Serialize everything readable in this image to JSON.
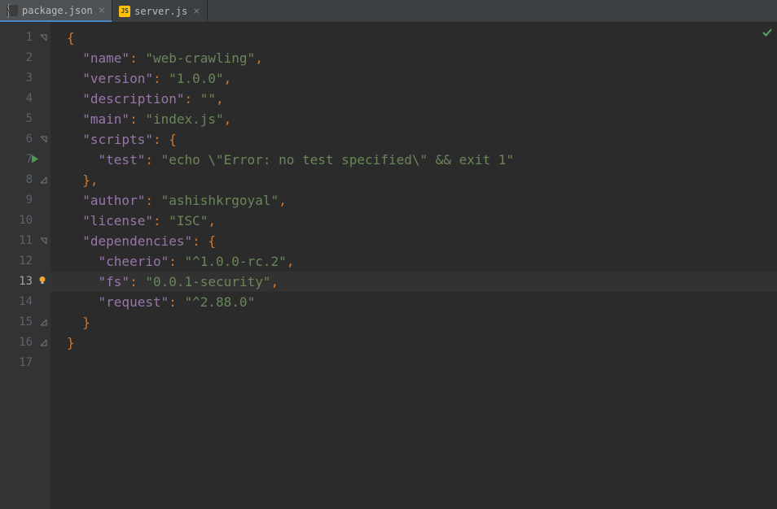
{
  "tabs": [
    {
      "label": "package.json",
      "active": true,
      "icon": "json"
    },
    {
      "label": "server.js",
      "active": false,
      "icon": "js"
    }
  ],
  "currentLine": 13,
  "lines": [
    {
      "num": "1",
      "fold": "open",
      "tokens": [
        [
          "p",
          "{"
        ]
      ]
    },
    {
      "num": "2",
      "tokens": [
        [
          "op",
          "  "
        ],
        [
          "s",
          "\"name\""
        ],
        [
          "c",
          ": "
        ],
        [
          "s",
          "\"web-crawling\""
        ],
        [
          "c",
          ","
        ]
      ]
    },
    {
      "num": "3",
      "tokens": [
        [
          "op",
          "  "
        ],
        [
          "s",
          "\"version\""
        ],
        [
          "c",
          ": "
        ],
        [
          "s",
          "\"1.0.0\""
        ],
        [
          "c",
          ","
        ]
      ]
    },
    {
      "num": "4",
      "tokens": [
        [
          "op",
          "  "
        ],
        [
          "s",
          "\"description\""
        ],
        [
          "c",
          ": "
        ],
        [
          "s",
          "\"\""
        ],
        [
          "c",
          ","
        ]
      ]
    },
    {
      "num": "5",
      "tokens": [
        [
          "op",
          "  "
        ],
        [
          "s",
          "\"main\""
        ],
        [
          "c",
          ": "
        ],
        [
          "s",
          "\"index.js\""
        ],
        [
          "c",
          ","
        ]
      ]
    },
    {
      "num": "6",
      "fold": "open",
      "tokens": [
        [
          "op",
          "  "
        ],
        [
          "s",
          "\"scripts\""
        ],
        [
          "c",
          ": "
        ],
        [
          "p",
          "{"
        ]
      ]
    },
    {
      "num": "7",
      "run": true,
      "tokens": [
        [
          "op",
          "    "
        ],
        [
          "s",
          "\"test\""
        ],
        [
          "c",
          ": "
        ],
        [
          "s",
          "\"echo \\\"Error: no test specified\\\" && exit 1\""
        ]
      ]
    },
    {
      "num": "8",
      "fold": "close",
      "tokens": [
        [
          "op",
          "  "
        ],
        [
          "p",
          "}"
        ],
        [
          "c",
          ","
        ]
      ]
    },
    {
      "num": "9",
      "tokens": [
        [
          "op",
          "  "
        ],
        [
          "s",
          "\"author\""
        ],
        [
          "c",
          ": "
        ],
        [
          "s",
          "\"ashishkrgoyal\""
        ],
        [
          "c",
          ","
        ]
      ]
    },
    {
      "num": "10",
      "tokens": [
        [
          "op",
          "  "
        ],
        [
          "s",
          "\"license\""
        ],
        [
          "c",
          ": "
        ],
        [
          "s",
          "\"ISC\""
        ],
        [
          "c",
          ","
        ]
      ]
    },
    {
      "num": "11",
      "fold": "open",
      "tokens": [
        [
          "op",
          "  "
        ],
        [
          "s",
          "\"dependencies\""
        ],
        [
          "c",
          ": "
        ],
        [
          "p",
          "{"
        ]
      ]
    },
    {
      "num": "12",
      "tokens": [
        [
          "op",
          "    "
        ],
        [
          "s",
          "\"cheerio\""
        ],
        [
          "c",
          ": "
        ],
        [
          "s",
          "\"^1.0.0-rc.2\""
        ],
        [
          "c",
          ","
        ]
      ]
    },
    {
      "num": "13",
      "bulb": true,
      "current": true,
      "tokens": [
        [
          "op",
          "    "
        ],
        [
          "s",
          "\"fs\""
        ],
        [
          "c",
          ": "
        ],
        [
          "s",
          "\"0.0.1-security\""
        ],
        [
          "c",
          ","
        ]
      ]
    },
    {
      "num": "14",
      "tokens": [
        [
          "op",
          "    "
        ],
        [
          "s",
          "\"request\""
        ],
        [
          "c",
          ": "
        ],
        [
          "s",
          "\"^2.88.0\""
        ]
      ]
    },
    {
      "num": "15",
      "fold": "close",
      "tokens": [
        [
          "op",
          "  "
        ],
        [
          "p",
          "}"
        ]
      ]
    },
    {
      "num": "16",
      "fold": "close",
      "tokens": [
        [
          "p",
          "}"
        ]
      ]
    },
    {
      "num": "17",
      "tokens": []
    }
  ],
  "file_content": {
    "name": "web-crawling",
    "version": "1.0.0",
    "description": "",
    "main": "index.js",
    "scripts": {
      "test": "echo \"Error: no test specified\" && exit 1"
    },
    "author": "ashishkrgoyal",
    "license": "ISC",
    "dependencies": {
      "cheerio": "^1.0.0-rc.2",
      "fs": "0.0.1-security",
      "request": "^2.88.0"
    }
  }
}
